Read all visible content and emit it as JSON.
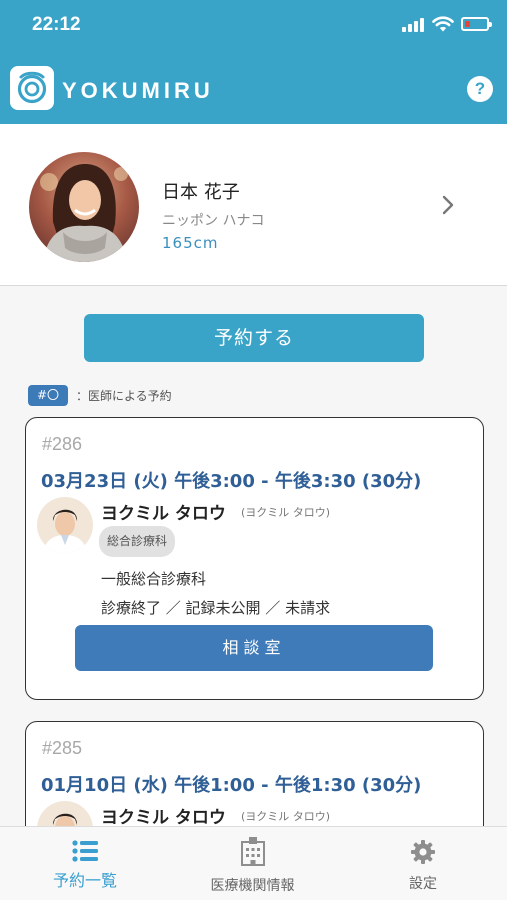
{
  "status_bar": {
    "time": "22:12"
  },
  "header": {
    "brand": "YOKUMIRU",
    "help_label": "?"
  },
  "profile": {
    "name": "日本 花子",
    "kana": "ニッポン ハナコ",
    "height": "165cm"
  },
  "actions": {
    "book_label": "予約する"
  },
  "legend": {
    "badge": "#〇",
    "text": "：医師による予約"
  },
  "appointments": [
    {
      "id": "#286",
      "time": "03月23日 (火) 午後3:00 - 午後3:30 (30分)",
      "doctor_name": "ヨクミル タロウ",
      "doctor_kana": "(ヨクミル タロウ)",
      "department_tag": "総合診療科",
      "department": "一般総合診療科",
      "status": "診療終了 ／ 記録未公開 ／ 未請求",
      "room_label": "相談室"
    },
    {
      "id": "#285",
      "time": "01月10日 (水) 午後1:00 - 午後1:30 (30分)",
      "doctor_name": "ヨクミル タロウ",
      "doctor_kana": "(ヨクミル タロウ)"
    }
  ],
  "tabs": [
    {
      "label": "予約一覧",
      "icon": "list-icon",
      "active": true
    },
    {
      "label": "医療機関情報",
      "icon": "hospital-icon",
      "active": false
    },
    {
      "label": "設定",
      "icon": "gear-icon",
      "active": false
    }
  ],
  "colors": {
    "header": "#3aa3c8",
    "primary_button": "#3aa3c8",
    "secondary_button": "#3f7bb8",
    "time_text": "#2f5f96",
    "active_tab": "#3a9fd0",
    "inactive_tab": "#8e8e8e"
  }
}
